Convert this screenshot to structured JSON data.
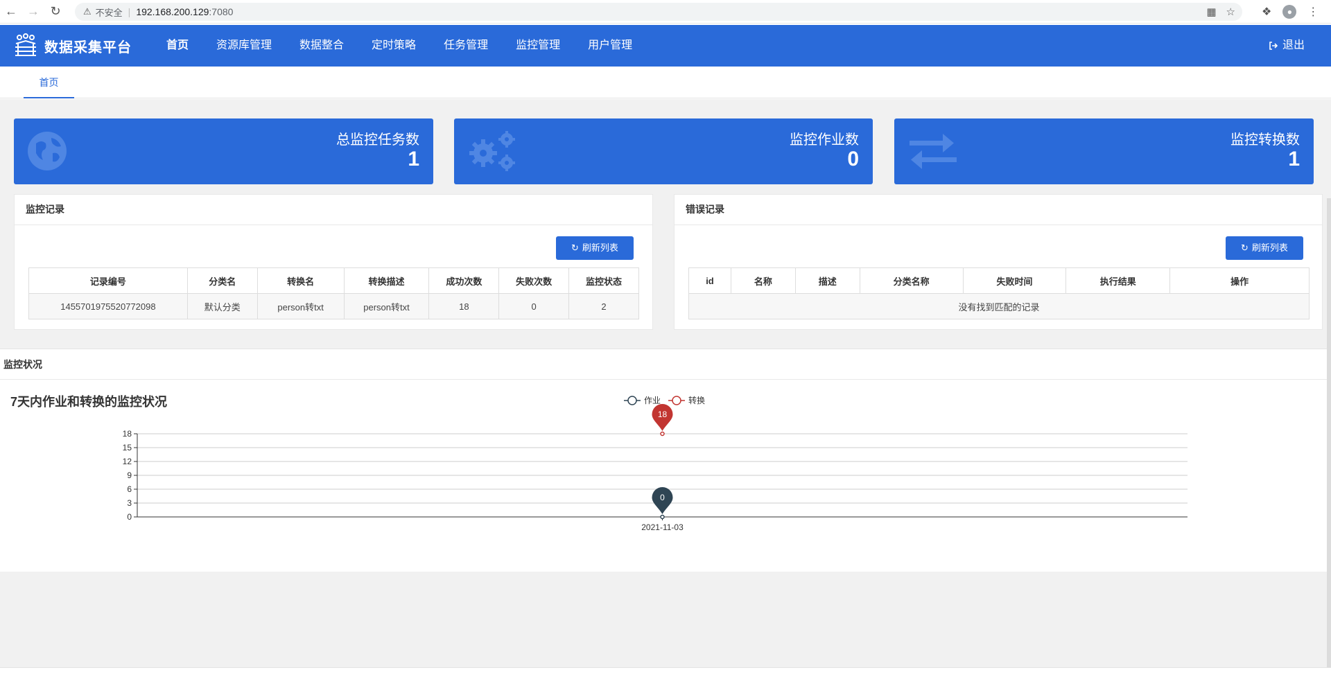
{
  "browser": {
    "insecure_label": "不安全",
    "url_host": "192.168.200.129",
    "url_port": ":7080"
  },
  "header": {
    "title": "数据采集平台",
    "menu": [
      {
        "label": "首页"
      },
      {
        "label": "资源库管理"
      },
      {
        "label": "数据整合"
      },
      {
        "label": "定时策略"
      },
      {
        "label": "任务管理"
      },
      {
        "label": "监控管理"
      },
      {
        "label": "用户管理"
      }
    ],
    "logout_label": "退出"
  },
  "tabs": [
    {
      "label": "首页"
    }
  ],
  "stats": [
    {
      "label": "总监控任务数",
      "value": "1",
      "icon": "globe-icon"
    },
    {
      "label": "监控作业数",
      "value": "0",
      "icon": "gears-icon"
    },
    {
      "label": "监控转换数",
      "value": "1",
      "icon": "exchange-icon"
    }
  ],
  "monitor_records": {
    "title": "监控记录",
    "refresh_label": "刷新列表",
    "columns": [
      "记录编号",
      "分类名",
      "转换名",
      "转换描述",
      "成功次数",
      "失败次数",
      "监控状态"
    ],
    "rows": [
      [
        "1455701975520772098",
        "默认分类",
        "person转txt",
        "person转txt",
        "18",
        "0",
        "2"
      ]
    ]
  },
  "error_records": {
    "title": "错误记录",
    "refresh_label": "刷新列表",
    "columns": [
      "id",
      "名称",
      "描述",
      "分类名称",
      "失败时间",
      "执行结果",
      "操作"
    ],
    "empty_text": "没有找到匹配的记录"
  },
  "monitor_status": {
    "title": "监控状况"
  },
  "chart_data": {
    "type": "line",
    "title": "7天内作业和转换的监控状况",
    "categories": [
      "2021-11-03"
    ],
    "series": [
      {
        "name": "作业",
        "values": [
          0
        ],
        "color": "#2f4554"
      },
      {
        "name": "转换",
        "values": [
          18
        ],
        "color": "#c23531"
      }
    ],
    "ylim": [
      0,
      18
    ],
    "yticks": [
      0,
      3,
      6,
      9,
      12,
      15,
      18
    ],
    "grid": true,
    "legend_position": "top-center",
    "markers": "pin-labels"
  }
}
